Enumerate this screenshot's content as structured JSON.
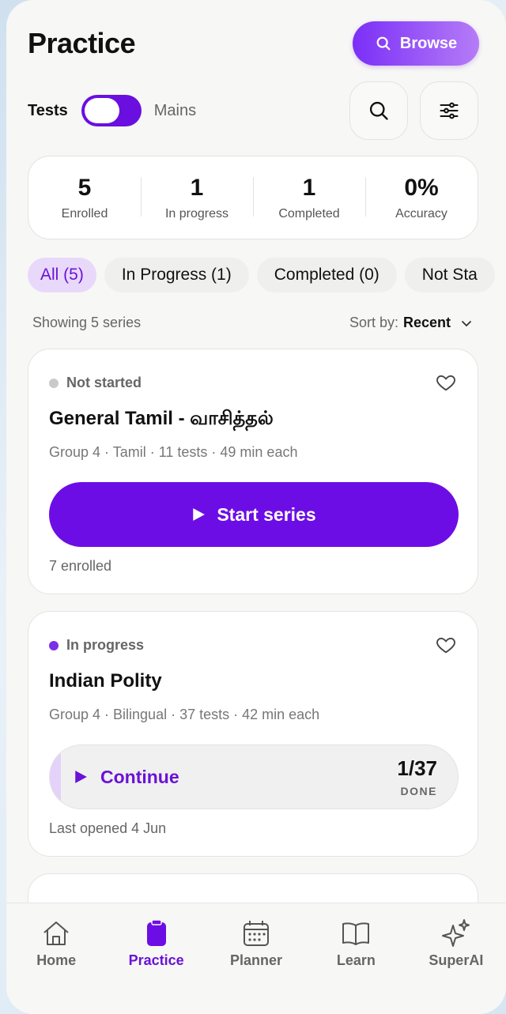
{
  "header": {
    "title": "Practice",
    "browse_label": "Browse"
  },
  "mode": {
    "left_label": "Tests",
    "right_label": "Mains",
    "toggle_on_side": "left"
  },
  "stats": [
    {
      "value": "5",
      "label": "Enrolled"
    },
    {
      "value": "1",
      "label": "In progress"
    },
    {
      "value": "1",
      "label": "Completed"
    },
    {
      "value": "0%",
      "label": "Accuracy"
    }
  ],
  "filters": [
    {
      "label": "All (5)",
      "active": true
    },
    {
      "label": "In Progress (1)",
      "active": false
    },
    {
      "label": "Completed (0)",
      "active": false
    },
    {
      "label": "Not Sta",
      "active": false
    }
  ],
  "list_meta": {
    "showing": "Showing 5 series",
    "sort_prefix": "Sort by:",
    "sort_value": "Recent"
  },
  "cards": [
    {
      "status": "Not started",
      "title": "General Tamil - வாசித்தல்",
      "meta": "Group 4 · Tamil · 11 tests · 49 min each",
      "action_label": "Start series",
      "footer": "7 enrolled"
    },
    {
      "status": "In progress",
      "title": "Indian Polity",
      "meta": "Group 4 · Bilingual · 37 tests · 42 min each",
      "action_label": "Continue",
      "progress": "1/37",
      "progress_fraction": 0.027,
      "progress_caption": "DONE",
      "footer": "Last opened 4 Jun"
    }
  ],
  "nav": [
    {
      "label": "Home",
      "icon": "home-icon",
      "active": false
    },
    {
      "label": "Practice",
      "icon": "clipboard-icon",
      "active": true
    },
    {
      "label": "Planner",
      "icon": "calendar-icon",
      "active": false
    },
    {
      "label": "Learn",
      "icon": "book-icon",
      "active": false
    },
    {
      "label": "SuperAI",
      "icon": "sparkles-icon",
      "active": false
    }
  ],
  "colors": {
    "accent": "#6d0de6",
    "accent_light": "#e8d9fb",
    "background": "#f7f7f5"
  }
}
